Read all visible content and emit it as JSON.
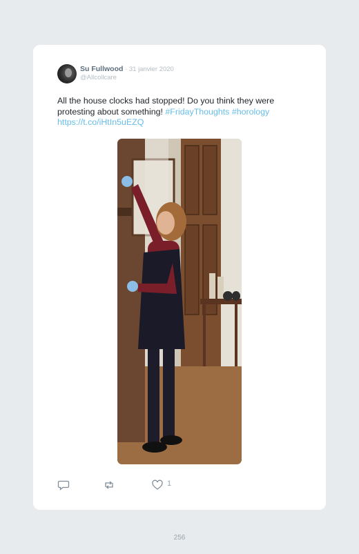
{
  "tweet": {
    "user_name": "Su Fullwood",
    "date": "31 janvier 2020",
    "separator": " · ",
    "handle": "@Allcollcare",
    "text_main": "All the house clocks had stopped! Do you think they were protesting about something!",
    "hashtag_1": "#FridayThoughts",
    "hashtag_2": "#horology",
    "link": "https://t.co/iHtIn5uEZQ",
    "photo_description": "person in red top and dark pinafore adjusting a tall wooden clock",
    "like_count": "1",
    "icons": [
      "reply-icon",
      "retweet-icon",
      "like-icon"
    ]
  },
  "page": {
    "number": "256"
  },
  "colors": {
    "link": "#67bde8",
    "background": "#e7ebee",
    "card": "#ffffff"
  }
}
